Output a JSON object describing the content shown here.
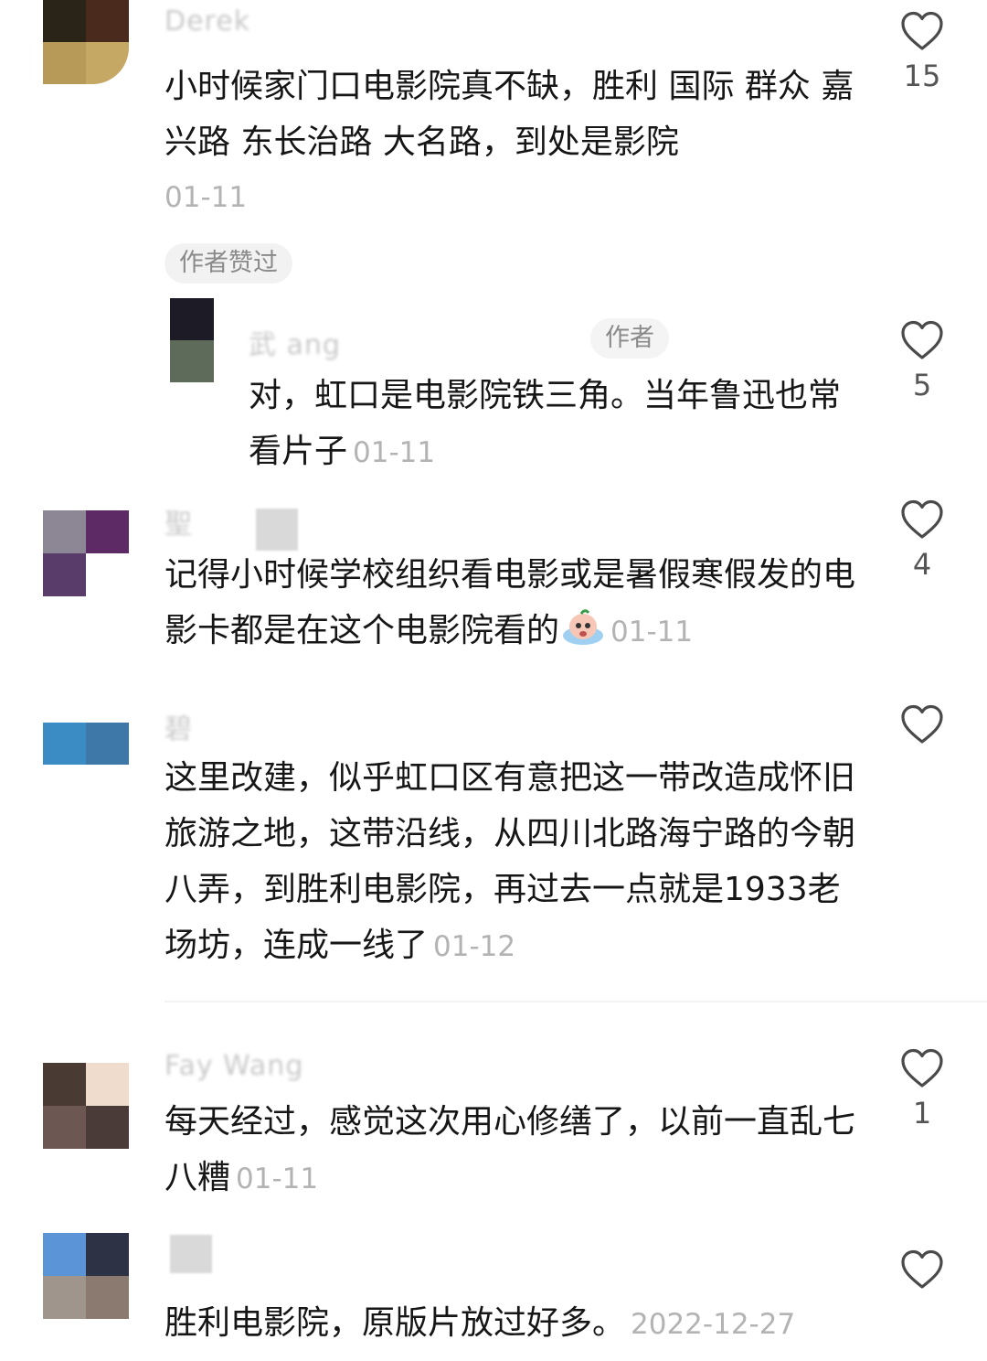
{
  "comments": [
    {
      "name": "Derek",
      "text": "小时候家门口电影院真不缺，胜利 国际 群众 嘉兴路 东长治路 大名路，到处是影院",
      "date": "01-11",
      "liked_by_author": "作者赞过",
      "likes": "15",
      "reply": {
        "name": "武 ang",
        "author_tag": "作者",
        "text": "对，虹口是电影院铁三角。当年鲁迅也常看片子",
        "date": "01-11",
        "likes": "5"
      }
    },
    {
      "name": "聖",
      "text": "记得小时候学校组织看电影或是暑假寒假发的电影卡都是在这个电影院看的",
      "emoji": "crying-emoji",
      "date": "01-11",
      "likes": "4"
    },
    {
      "name": "碧",
      "text": "这里改建，似乎虹口区有意把这一带改造成怀旧旅游之地，这带沿线，从四川北路海宁路的今朝八弄，到胜利电影院，再过去一点就是1933老场坊，连成一线了",
      "date": "01-12",
      "likes": ""
    },
    {
      "name": "Fay Wang",
      "text": "每天经过，感觉这次用心修缮了，以前一直乱七八糟",
      "date": "01-11",
      "likes": "1"
    },
    {
      "name": "",
      "text": "胜利电影院，原版片放过好多。",
      "date": "2022-12-27",
      "likes": ""
    }
  ],
  "icons": {
    "like": "heart-outline-icon"
  },
  "colors": {
    "text": "#161616",
    "muted": "#b3b3b3",
    "tag_bg": "#f2f2f2"
  }
}
